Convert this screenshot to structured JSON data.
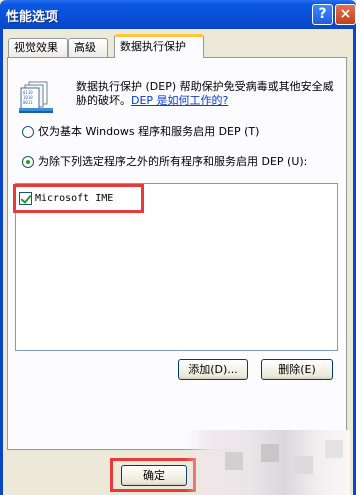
{
  "window": {
    "title": "性能选项",
    "help_glyph": "?",
    "close_glyph": "×"
  },
  "tabs": [
    {
      "label": "视觉效果"
    },
    {
      "label": "高级"
    },
    {
      "label": "数据执行保护"
    }
  ],
  "dep": {
    "description": "数据执行保护 (DEP) 帮助保护免受病毒或其他安全威胁的破坏。",
    "link": "DEP 是如何工作的?",
    "option1": "仅为基本 Windows 程序和服务启用 DEP (T)",
    "option2": "为除下列选定程序之外的所有程序和服务启用 DEP (U):",
    "selected_option": 2
  },
  "program_list": [
    {
      "name": "Microsoft IME",
      "checked": true
    }
  ],
  "buttons": {
    "add": "添加(D)...",
    "remove": "删除(E)",
    "ok": "确定"
  },
  "colors": {
    "title_bar": "#0a4fd6",
    "highlight": "#e83a3a",
    "active_tab_accent": "#ffc83c"
  }
}
